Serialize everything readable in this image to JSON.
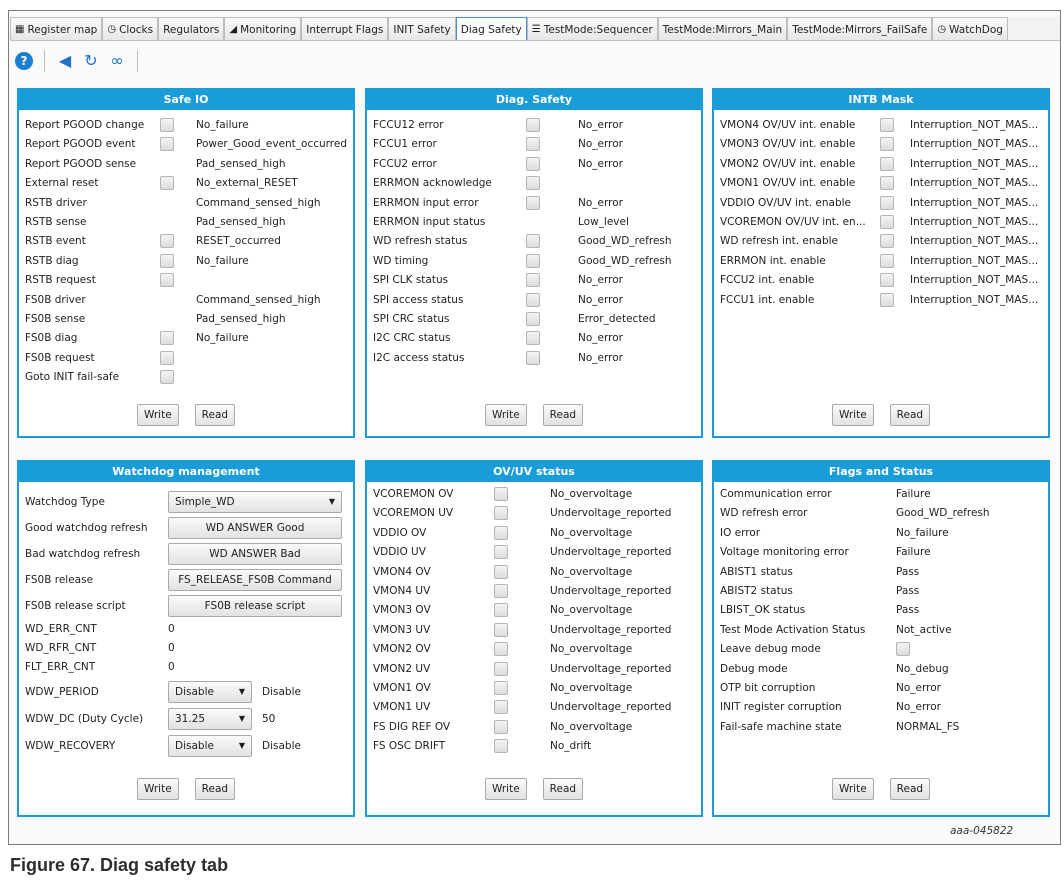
{
  "tabs": [
    {
      "icon": "register-map-icon",
      "glyph": "▦",
      "label": "Register map"
    },
    {
      "icon": "clock-icon",
      "glyph": "◷",
      "label": "Clocks"
    },
    {
      "icon": "",
      "glyph": "",
      "label": "Regulators"
    },
    {
      "icon": "monitoring-icon",
      "glyph": "◢",
      "label": "Monitoring"
    },
    {
      "icon": "",
      "glyph": "",
      "label": "Interrupt Flags"
    },
    {
      "icon": "",
      "glyph": "",
      "label": "INIT Safety"
    },
    {
      "icon": "",
      "glyph": "",
      "label": "Diag Safety",
      "active": true
    },
    {
      "icon": "list-icon",
      "glyph": "☰",
      "label": "TestMode:Sequencer"
    },
    {
      "icon": "",
      "glyph": "",
      "label": "TestMode:Mirrors_Main"
    },
    {
      "icon": "",
      "glyph": "",
      "label": "TestMode:Mirrors_FailSafe"
    },
    {
      "icon": "clock-icon",
      "glyph": "◷",
      "label": "WatchDog"
    }
  ],
  "toolbar": {
    "help_glyph": "?",
    "send_glyph": "◀",
    "refresh_glyph": "↻",
    "loop_glyph": "∞"
  },
  "safe_io": {
    "title": "Safe IO",
    "rows": [
      {
        "label": "Report PGOOD change",
        "checkbox": true,
        "value": "No_failure"
      },
      {
        "label": "Report PGOOD event",
        "checkbox": true,
        "value": "Power_Good_event_occurred"
      },
      {
        "label": "Report PGOOD sense",
        "checkbox": false,
        "value": "Pad_sensed_high"
      },
      {
        "label": "External reset",
        "checkbox": true,
        "value": "No_external_RESET"
      },
      {
        "label": "RSTB driver",
        "checkbox": false,
        "value": "Command_sensed_high"
      },
      {
        "label": "RSTB sense",
        "checkbox": false,
        "value": "Pad_sensed_high"
      },
      {
        "label": "RSTB event",
        "checkbox": true,
        "value": "RESET_occurred"
      },
      {
        "label": "RSTB diag",
        "checkbox": true,
        "value": "No_failure"
      },
      {
        "label": "RSTB request",
        "checkbox": true,
        "value": ""
      },
      {
        "label": "FS0B driver",
        "checkbox": false,
        "value": "Command_sensed_high"
      },
      {
        "label": "FS0B sense",
        "checkbox": false,
        "value": "Pad_sensed_high"
      },
      {
        "label": "FS0B diag",
        "checkbox": true,
        "value": "No_failure"
      },
      {
        "label": "FS0B request",
        "checkbox": true,
        "value": ""
      },
      {
        "label": "Goto INIT fail-safe",
        "checkbox": true,
        "value": ""
      }
    ],
    "write_label": "Write",
    "read_label": "Read"
  },
  "diag_safety": {
    "title": "Diag. Safety",
    "rows": [
      {
        "label": "FCCU12 error",
        "checkbox": true,
        "value": "No_error"
      },
      {
        "label": "FCCU1 error",
        "checkbox": true,
        "value": "No_error"
      },
      {
        "label": "FCCU2 error",
        "checkbox": true,
        "value": "No_error"
      },
      {
        "label": "ERRMON acknowledge",
        "checkbox": true,
        "value": ""
      },
      {
        "label": "ERRMON input error",
        "checkbox": true,
        "value": "No_error"
      },
      {
        "label": "ERRMON input status",
        "checkbox": false,
        "value": "Low_level"
      },
      {
        "label": "WD refresh status",
        "checkbox": true,
        "value": "Good_WD_refresh"
      },
      {
        "label": "WD timing",
        "checkbox": true,
        "value": "Good_WD_refresh"
      },
      {
        "label": "SPI CLK status",
        "checkbox": true,
        "value": "No_error"
      },
      {
        "label": "SPI access status",
        "checkbox": true,
        "value": "No_error"
      },
      {
        "label": "SPI CRC status",
        "checkbox": true,
        "value": "Error_detected"
      },
      {
        "label": "I2C CRC status",
        "checkbox": true,
        "value": "No_error"
      },
      {
        "label": "I2C access status",
        "checkbox": true,
        "value": "No_error"
      }
    ],
    "write_label": "Write",
    "read_label": "Read"
  },
  "intb_mask": {
    "title": "INTB Mask",
    "rows": [
      {
        "label": "VMON4 OV/UV int. enable",
        "checkbox": true,
        "value": "Interruption_NOT_MAS..."
      },
      {
        "label": "VMON3 OV/UV int. enable",
        "checkbox": true,
        "value": "Interruption_NOT_MAS..."
      },
      {
        "label": "VMON2 OV/UV int. enable",
        "checkbox": true,
        "value": "Interruption_NOT_MAS..."
      },
      {
        "label": "VMON1 OV/UV int. enable",
        "checkbox": true,
        "value": "Interruption_NOT_MAS..."
      },
      {
        "label": "VDDIO OV/UV int. enable",
        "checkbox": true,
        "value": "Interruption_NOT_MAS..."
      },
      {
        "label": "VCOREMON OV/UV int. en...",
        "checkbox": true,
        "value": "Interruption_NOT_MAS..."
      },
      {
        "label": "WD refresh int. enable",
        "checkbox": true,
        "value": "Interruption_NOT_MAS..."
      },
      {
        "label": "ERRMON int. enable",
        "checkbox": true,
        "value": "Interruption_NOT_MAS..."
      },
      {
        "label": "FCCU2 int. enable",
        "checkbox": true,
        "value": "Interruption_NOT_MAS..."
      },
      {
        "label": "FCCU1 int. enable",
        "checkbox": true,
        "value": "Interruption_NOT_MAS..."
      }
    ],
    "write_label": "Write",
    "read_label": "Read"
  },
  "watchdog": {
    "title": "Watchdog management",
    "type_label": "Watchdog Type",
    "type_value": "Simple_WD",
    "good_label": "Good watchdog refresh",
    "good_button": "WD ANSWER Good",
    "bad_label": "Bad watchdog refresh",
    "bad_button": "WD ANSWER Bad",
    "fs0b_label": "FS0B release",
    "fs0b_button": "FS_RELEASE_FS0B Command",
    "script_label": "FS0B release script",
    "script_button": "FS0B release script",
    "wd_err_label": "WD_ERR_CNT",
    "wd_err_value": "0",
    "wd_rfr_label": "WD_RFR_CNT",
    "wd_rfr_value": "0",
    "flt_err_label": "FLT_ERR_CNT",
    "flt_err_value": "0",
    "period_label": "WDW_PERIOD",
    "period_select": "Disable",
    "period_value": "Disable",
    "dc_label": "WDW_DC (Duty Cycle)",
    "dc_select": "31.25",
    "dc_value": "50",
    "recovery_label": "WDW_RECOVERY",
    "recovery_select": "Disable",
    "recovery_value": "Disable",
    "write_label": "Write",
    "read_label": "Read"
  },
  "ovuv": {
    "title": "OV/UV status",
    "rows": [
      {
        "label": "VCOREMON OV",
        "checkbox": true,
        "value": "No_overvoltage"
      },
      {
        "label": "VCOREMON UV",
        "checkbox": true,
        "value": "Undervoltage_reported"
      },
      {
        "label": "VDDIO OV",
        "checkbox": true,
        "value": "No_overvoltage"
      },
      {
        "label": "VDDIO UV",
        "checkbox": true,
        "value": "Undervoltage_reported"
      },
      {
        "label": "VMON4 OV",
        "checkbox": true,
        "value": "No_overvoltage"
      },
      {
        "label": "VMON4 UV",
        "checkbox": true,
        "value": "Undervoltage_reported"
      },
      {
        "label": "VMON3 OV",
        "checkbox": true,
        "value": "No_overvoltage"
      },
      {
        "label": "VMON3 UV",
        "checkbox": true,
        "value": "Undervoltage_reported"
      },
      {
        "label": "VMON2 OV",
        "checkbox": true,
        "value": "No_overvoltage"
      },
      {
        "label": "VMON2 UV",
        "checkbox": true,
        "value": "Undervoltage_reported"
      },
      {
        "label": "VMON1 OV",
        "checkbox": true,
        "value": "No_overvoltage"
      },
      {
        "label": "VMON1 UV",
        "checkbox": true,
        "value": "Undervoltage_reported"
      },
      {
        "label": "FS DIG REF OV",
        "checkbox": true,
        "value": "No_overvoltage"
      },
      {
        "label": "FS OSC DRIFT",
        "checkbox": true,
        "value": "No_drift"
      }
    ],
    "write_label": "Write",
    "read_label": "Read"
  },
  "flags": {
    "title": "Flags and Status",
    "rows": [
      {
        "label": "Communication error",
        "checkbox": false,
        "value": "Failure"
      },
      {
        "label": "WD refresh error",
        "checkbox": false,
        "value": "Good_WD_refresh"
      },
      {
        "label": "IO error",
        "checkbox": false,
        "value": "No_failure"
      },
      {
        "label": "Voltage monitoring error",
        "checkbox": false,
        "value": "Failure"
      },
      {
        "label": "ABIST1 status",
        "checkbox": false,
        "value": "Pass"
      },
      {
        "label": "ABIST2 status",
        "checkbox": false,
        "value": "Pass"
      },
      {
        "label": "LBIST_OK status",
        "checkbox": false,
        "value": "Pass"
      },
      {
        "label": "Test Mode Activation Status",
        "checkbox": false,
        "value": "Not_active"
      },
      {
        "label": "Leave debug mode",
        "checkbox": true,
        "value": ""
      },
      {
        "label": "Debug mode",
        "checkbox": false,
        "value": "No_debug"
      },
      {
        "label": "OTP bit corruption",
        "checkbox": false,
        "value": "No_error"
      },
      {
        "label": "INIT register corruption",
        "checkbox": false,
        "value": "No_error"
      },
      {
        "label": "Fail-safe machine state",
        "checkbox": false,
        "value": "NORMAL_FS"
      }
    ],
    "write_label": "Write",
    "read_label": "Read"
  },
  "watermark": "aaa-045822",
  "caption": "Figure 67.  Diag safety tab",
  "colors": {
    "panel_header": "#1a9cd8",
    "active_tab_border": "#4a90d9",
    "help_button": "#1c7fd1"
  }
}
